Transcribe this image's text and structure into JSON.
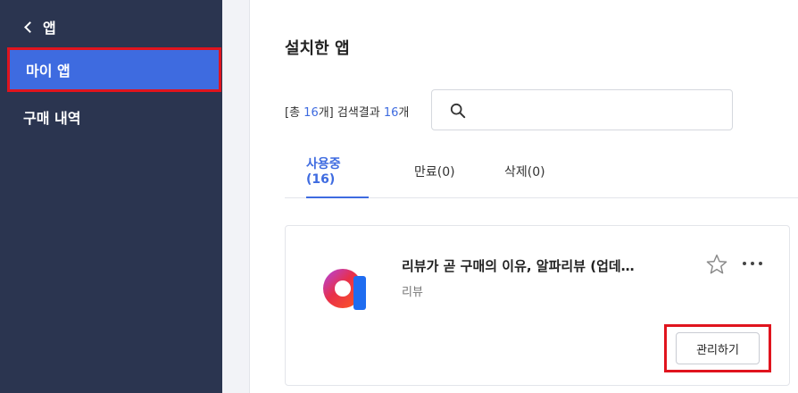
{
  "sidebar": {
    "back_label": "앱",
    "items": [
      {
        "label": "마이 앱"
      },
      {
        "label": "구매 내역"
      }
    ]
  },
  "main": {
    "title": "설치한 앱",
    "count": {
      "prefix": "[총 ",
      "total": "16",
      "mid": "개] 검색결과 ",
      "results": "16",
      "suffix": "개"
    },
    "search": {
      "placeholder": ""
    },
    "tabs": [
      {
        "label": "사용중(16)"
      },
      {
        "label": "만료(0)"
      },
      {
        "label": "삭제(0)"
      }
    ],
    "app": {
      "name": "리뷰가 곧 구매의 이유, 알파리뷰 (업데이트)",
      "category": "리뷰",
      "manage_label": "관리하기"
    }
  },
  "colors": {
    "accent": "#3e6be0",
    "sidebar_bg": "#2b3550",
    "highlight": "#e0141e"
  }
}
